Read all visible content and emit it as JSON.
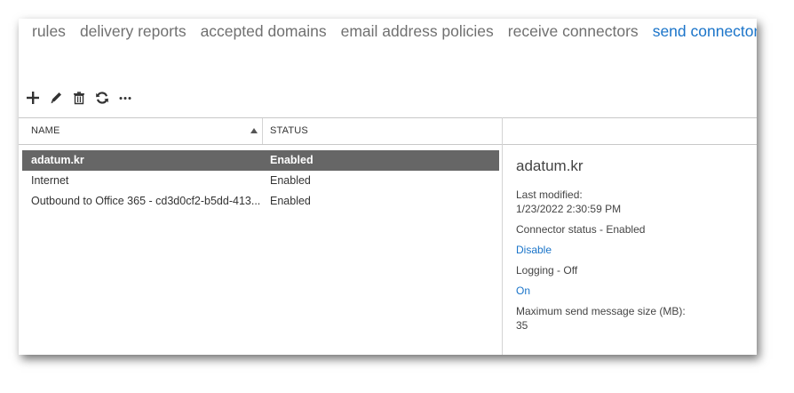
{
  "nav": {
    "tabs": [
      {
        "label": "rules",
        "active": false
      },
      {
        "label": "delivery reports",
        "active": false
      },
      {
        "label": "accepted domains",
        "active": false
      },
      {
        "label": "email address policies",
        "active": false
      },
      {
        "label": "receive connectors",
        "active": false
      },
      {
        "label": "send connectors",
        "active": true
      }
    ]
  },
  "toolbar": {
    "icons": [
      "add-icon",
      "edit-icon",
      "delete-icon",
      "refresh-icon",
      "more-icon"
    ],
    "more_label": "•••"
  },
  "table": {
    "columns": [
      "NAME",
      "STATUS"
    ],
    "sort": "name-ascending",
    "rows": [
      {
        "name": "adatum.kr",
        "status": "Enabled",
        "selected": true
      },
      {
        "name": "Internet",
        "status": "Enabled",
        "selected": false
      },
      {
        "name": "Outbound to Office 365 - cd3d0cf2-b5dd-413...",
        "status": "Enabled",
        "selected": false
      }
    ]
  },
  "details": {
    "title": "adatum.kr",
    "last_modified_label": "Last modified:",
    "last_modified_value": "1/23/2022 2:30:59 PM",
    "connector_status": "Connector status - Enabled",
    "disable_link": "Disable",
    "logging": "Logging - Off",
    "on_link": "On",
    "max_size_label": "Maximum send message size (MB):",
    "max_size_value": "35"
  },
  "colors": {
    "accent": "#1a74c9",
    "selected_row": "#666666",
    "tab_text": "#707070"
  }
}
